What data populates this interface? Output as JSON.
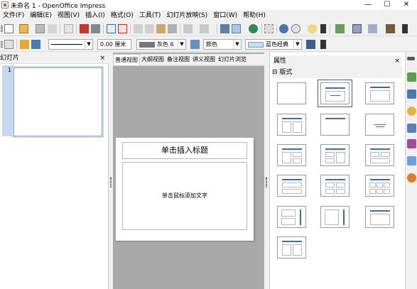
{
  "window": {
    "title": "未命名 1 - OpenOffice Impress",
    "minimize": "—",
    "maximize": "☐",
    "close": "✕"
  },
  "menu": [
    "文件(F)",
    "编辑(E)",
    "视图(V)",
    "插入(I)",
    "格式(O)",
    "工具(T)",
    "幻灯片放映(S)",
    "窗口(W)",
    "帮助(H)"
  ],
  "toolbar2": {
    "line_width": "0.00 厘米",
    "fill_color": "灰色 6",
    "fill_type": "颜色",
    "fill_value": "蓝色经典"
  },
  "slides_panel": {
    "title": "幻灯片",
    "slide_number": "1"
  },
  "view_tabs": [
    "普通视图",
    "大纲视图",
    "备注视图",
    "讲义视图",
    "幻灯片浏览"
  ],
  "slide": {
    "title_placeholder": "单击插入标题",
    "body_placeholder": "单击鼠标添加文字"
  },
  "properties": {
    "title": "属性",
    "section": "版式",
    "section_toggle": "⊟",
    "close": "×"
  },
  "colors": {
    "accent": "#3a6ea5",
    "selection": "#c7d7ec"
  }
}
